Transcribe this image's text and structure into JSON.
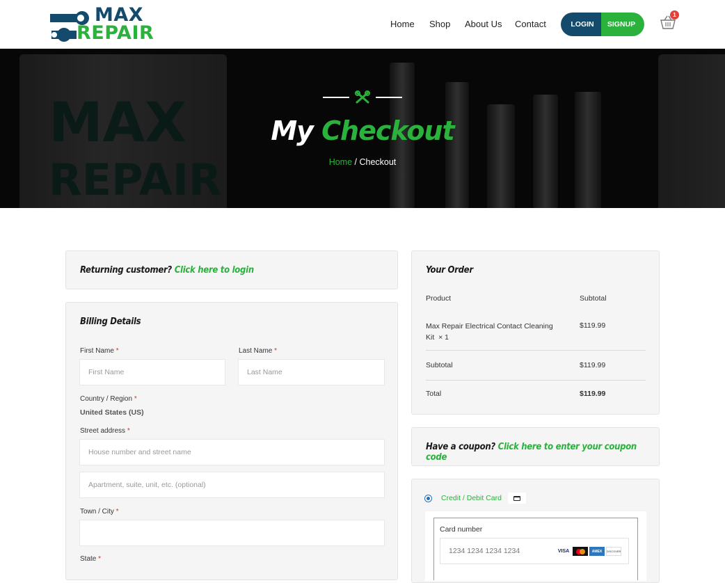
{
  "brand": {
    "line1": "MAX",
    "line2": "REPAIR",
    "primary": "#144a6b",
    "accent": "#2bb23c"
  },
  "nav": {
    "items": [
      "Home",
      "Shop",
      "About Us",
      "Contact"
    ]
  },
  "auth": {
    "login": "LOGIN",
    "signup": "SIGNUP"
  },
  "cart": {
    "count": "1",
    "icon": "basket-icon"
  },
  "hero": {
    "title_a": "My",
    "title_b": "Checkout",
    "breadcrumb_home": "Home",
    "breadcrumb_sep": " / ",
    "breadcrumb_current": "Checkout",
    "bg_text_1": "MAX",
    "bg_text_2": "REPAIR"
  },
  "returning": {
    "prompt": "Returning customer?",
    "link": "Click here to login"
  },
  "billing": {
    "title": "Billing Details",
    "first_name_label": "First Name",
    "first_name_placeholder": "First Name",
    "last_name_label": "Last Name",
    "last_name_placeholder": "Last Name",
    "country_label": "Country / Region",
    "country_value": "United States (US)",
    "street_label": "Street address",
    "street_placeholder": "House number and street name",
    "apt_placeholder": "Apartment, suite, unit, etc. (optional)",
    "city_label": "Town / City",
    "state_label": "State",
    "required_mark": "*"
  },
  "order": {
    "title": "Your Order",
    "col_product": "Product",
    "col_subtotal": "Subtotal",
    "item_name": "Max Repair Electrical Contact Cleaning Kit",
    "item_qty": "× 1",
    "item_price": "$119.99",
    "subtotal_label": "Subtotal",
    "subtotal_value": "$119.99",
    "total_label": "Total",
    "total_value": "$119.99"
  },
  "coupon": {
    "prompt": "Have a coupon?",
    "link": "Click here to enter your coupon code"
  },
  "payment": {
    "method_label": "Credit / Debit Card",
    "card_number_label": "Card number",
    "card_number_placeholder": "1234 1234 1234 1234",
    "brands": [
      "VISA",
      "mastercard",
      "AMEX",
      "DISCOVER"
    ]
  }
}
